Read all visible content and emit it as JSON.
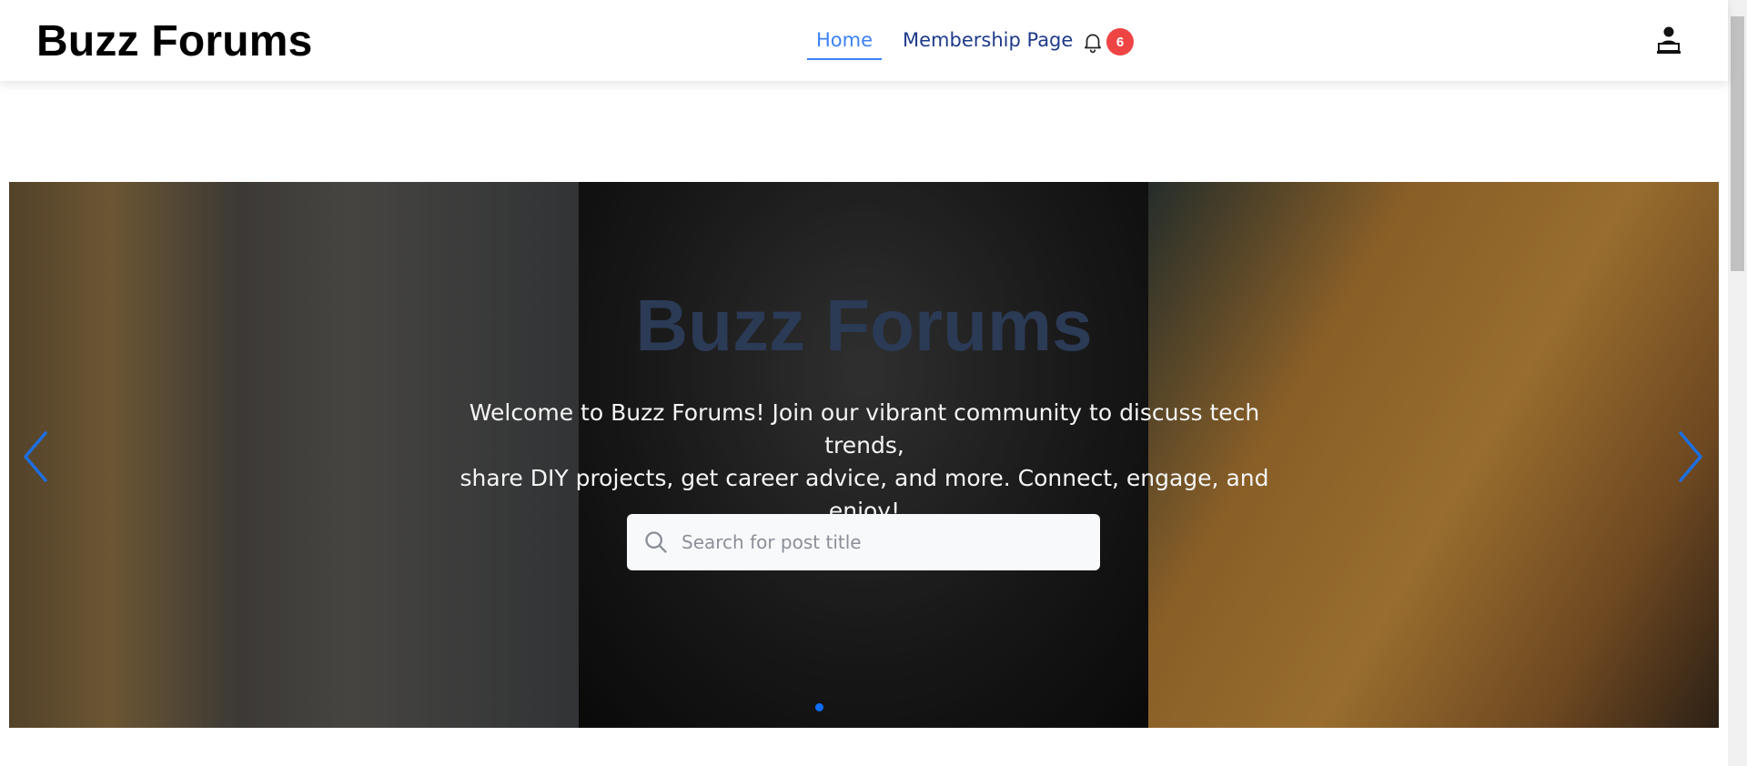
{
  "header": {
    "logo": "Buzz Forums",
    "nav": {
      "home": "Home",
      "membership": "Membership Page"
    },
    "notifications_count": "6",
    "bell_icon": "bell-icon",
    "profile_icon": "user-profile-icon"
  },
  "hero": {
    "title": "Buzz Forums",
    "subtitle_line1": "Welcome to Buzz Forums! Join our vibrant community to discuss tech trends,",
    "subtitle_line2": "share DIY projects, get career advice, and more. Connect, engage, and enjoy!",
    "search": {
      "placeholder": "Search for post title",
      "value": ""
    },
    "carousel": {
      "active_slide": 1,
      "total_slides": 1
    }
  },
  "colors": {
    "accent": "#3b82f6",
    "nav_text": "#1e3a8a",
    "badge": "#ef4444",
    "hero_title": "#2b3a55",
    "arrow": "#1d6fe0"
  }
}
